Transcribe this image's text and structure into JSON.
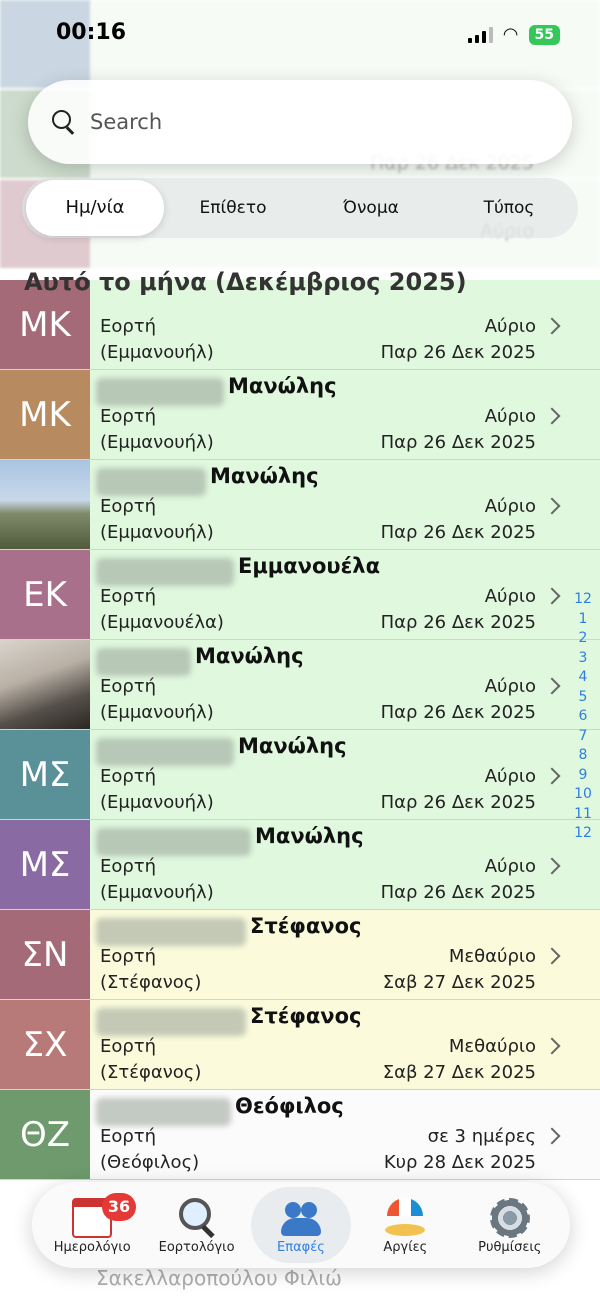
{
  "status": {
    "time": "00:16",
    "battery": "55"
  },
  "search": {
    "placeholder": "Search"
  },
  "segments": [
    {
      "label": "Ημ/νία",
      "active": true
    },
    {
      "label": "Επίθετο",
      "active": false
    },
    {
      "label": "Όνομα",
      "active": false
    },
    {
      "label": "Τύπος",
      "active": false
    }
  ],
  "section_title": "Αυτό το μήνα (Δεκέμβριος 2025)",
  "rows": [
    {
      "initials": "ΜΚ",
      "avatar_color": "#a46a78",
      "first_name": "",
      "type": "Εορτή",
      "paren": "(Εμμανουήλ)",
      "when": "Αύριο",
      "date": "Παρ 26 Δεκ 2025",
      "tint": "green"
    },
    {
      "initials": "ΜΚ",
      "avatar_color": "#b78b5f",
      "first_name": "Μανώλης",
      "type": "Εορτή",
      "paren": "(Εμμανουήλ)",
      "when": "Αύριο",
      "date": "Παρ 26 Δεκ 2025",
      "tint": "green"
    },
    {
      "initials": "",
      "avatar_color": "photo-plane",
      "first_name": "Μανώλης",
      "type": "Εορτή",
      "paren": "(Εμμανουήλ)",
      "when": "Αύριο",
      "date": "Παρ 26 Δεκ 2025",
      "tint": "green"
    },
    {
      "initials": "ΕΚ",
      "avatar_color": "#a8708a",
      "first_name": "Εμμανουέλα",
      "type": "Εορτή",
      "paren": "(Εμμανουέλα)",
      "when": "Αύριο",
      "date": "Παρ 26 Δεκ 2025",
      "tint": "green"
    },
    {
      "initials": "",
      "avatar_color": "photo-paris",
      "first_name": "Μανώλης",
      "type": "Εορτή",
      "paren": "(Εμμανουήλ)",
      "when": "Αύριο",
      "date": "Παρ 26 Δεκ 2025",
      "tint": "green"
    },
    {
      "initials": "ΜΣ",
      "avatar_color": "#5a9199",
      "first_name": "Μανώλης",
      "type": "Εορτή",
      "paren": "(Εμμανουήλ)",
      "when": "Αύριο",
      "date": "Παρ 26 Δεκ 2025",
      "tint": "green"
    },
    {
      "initials": "ΜΣ",
      "avatar_color": "#8a6aa2",
      "first_name": "Μανώλης",
      "type": "Εορτή",
      "paren": "(Εμμανουήλ)",
      "when": "Αύριο",
      "date": "Παρ 26 Δεκ 2025",
      "tint": "green"
    },
    {
      "initials": "ΣΝ",
      "avatar_color": "#a46a78",
      "first_name": "Στέφανος",
      "type": "Εορτή",
      "paren": "(Στέφανος)",
      "when": "Μεθαύριο",
      "date": "Σαβ 27 Δεκ 2025",
      "tint": "yellow"
    },
    {
      "initials": "ΣΧ",
      "avatar_color": "#b87a78",
      "first_name": "Στέφανος",
      "type": "Εορτή",
      "paren": "(Στέφανος)",
      "when": "Μεθαύριο",
      "date": "Σαβ 27 Δεκ 2025",
      "tint": "yellow"
    },
    {
      "initials": "ΘΖ",
      "avatar_color": "#6e9a6e",
      "first_name": "Θεόφιλος",
      "type": "Εορτή",
      "paren": "(Θεόφιλος)",
      "when": "σε 3 ημέρες",
      "date": "Κυρ 28 Δεκ 2025",
      "tint": "white"
    }
  ],
  "index": [
    "12",
    "1",
    "2",
    "3",
    "4",
    "5",
    "6",
    "7",
    "8",
    "9",
    "10",
    "11",
    "12"
  ],
  "tabs": [
    {
      "label": "Ημερολόγιο",
      "icon": "calendar-icon",
      "badge": "36",
      "active": false
    },
    {
      "label": "Εορτολόγιο",
      "icon": "magnifier-icon",
      "badge": "",
      "active": false
    },
    {
      "label": "Επαφές",
      "icon": "people-icon",
      "badge": "",
      "active": true
    },
    {
      "label": "Αργίες",
      "icon": "beach-umbrella-icon",
      "badge": "",
      "active": false
    },
    {
      "label": "Ρυθμίσεις",
      "icon": "gear-icon",
      "badge": "",
      "active": false
    }
  ],
  "ghost": {
    "line1": "Παρ 26 Δεκ 2025",
    "line2": "Αύριο",
    "bottom": "Σακελλαροπούλου Φιλιώ"
  }
}
